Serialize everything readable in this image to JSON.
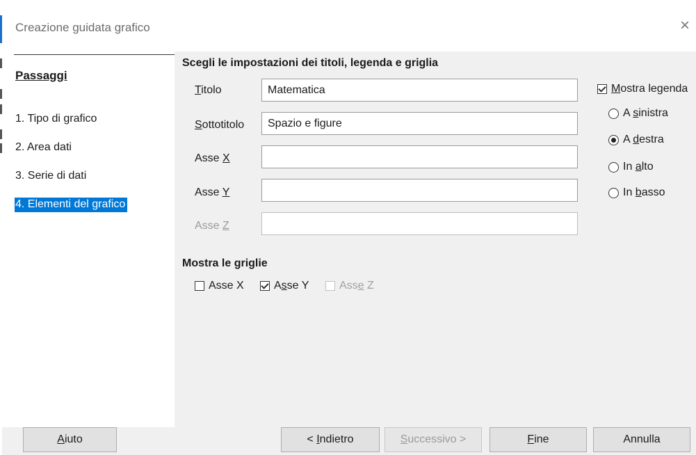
{
  "window": {
    "title": "Creazione guidata grafico",
    "close_glyph": "×"
  },
  "steps": {
    "heading": "Passaggi",
    "items": [
      {
        "label": "1. Tipo di grafico",
        "active": false
      },
      {
        "label": "2. Area dati",
        "active": false
      },
      {
        "label": "3. Serie di dati",
        "active": false
      },
      {
        "label": "4. Elementi del grafico",
        "active": true
      }
    ]
  },
  "main": {
    "section_title": "Scegli le impostazioni dei titoli, legenda e griglia",
    "fields": {
      "title": {
        "label_mnemonic": "T",
        "label_rest": "itolo",
        "value": "Matematica"
      },
      "subtitle": {
        "label_mnemonic": "S",
        "label_rest": "ottotitolo",
        "value": "Spazio e figure"
      },
      "x_axis": {
        "label_before": "Asse ",
        "label_mnemonic": "X",
        "value": ""
      },
      "y_axis": {
        "label_before": "Asse ",
        "label_mnemonic": "Y",
        "value": ""
      },
      "z_axis": {
        "label_before": "Asse ",
        "label_mnemonic": "Z",
        "value": "",
        "disabled": true
      }
    },
    "legend": {
      "show_label_mnemonic": "M",
      "show_label_rest": "ostra legenda",
      "show_checked": true,
      "selected": "A destra",
      "positions": {
        "left": {
          "before": "A ",
          "mnemonic": "s",
          "after": "inistra"
        },
        "right": {
          "before": "A ",
          "mnemonic": "d",
          "after": "estra"
        },
        "top": {
          "before": "In ",
          "mnemonic": "a",
          "after": "lto"
        },
        "bottom": {
          "before": "In ",
          "mnemonic": "b",
          "after": "asso"
        }
      }
    },
    "grids": {
      "heading": "Mostra le griglie",
      "x": {
        "label": "Asse X",
        "checked": false
      },
      "y": {
        "before": "A",
        "mnemonic": "s",
        "after": "se Y",
        "checked": true
      },
      "z": {
        "before": "Ass",
        "mnemonic": "e",
        "after": " Z",
        "checked": false,
        "disabled": true
      }
    }
  },
  "footer": {
    "help": {
      "mnemonic": "A",
      "rest": "iuto"
    },
    "back": {
      "before": "< ",
      "mnemonic": "I",
      "after": "ndietro"
    },
    "next": {
      "before": "",
      "mnemonic": "S",
      "after": "uccessivo >",
      "disabled": true
    },
    "finish": {
      "mnemonic": "F",
      "rest": "ine"
    },
    "cancel": {
      "label": "Annulla"
    }
  }
}
